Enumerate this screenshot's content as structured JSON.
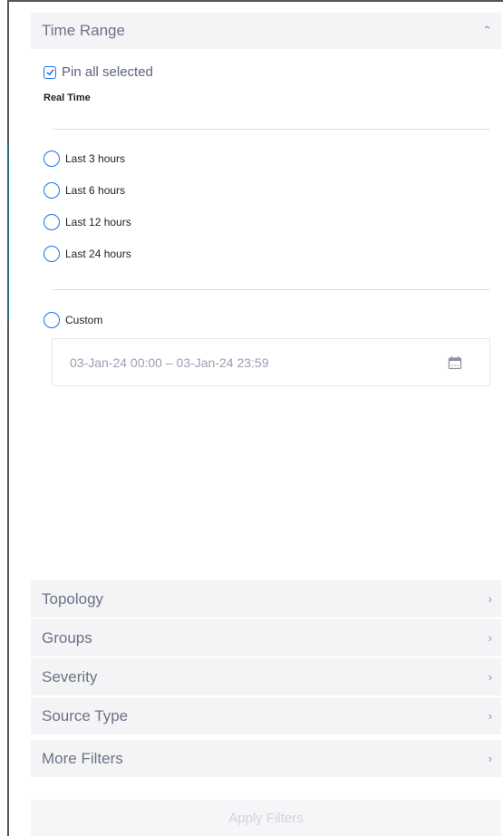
{
  "time_range": {
    "title": "Time Range",
    "pin_label": "Pin all selected",
    "realtime_label": "Real Time",
    "options": [
      {
        "label": "Last 3 hours"
      },
      {
        "label": "Last 6 hours"
      },
      {
        "label": "Last 12 hours"
      },
      {
        "label": "Last 24 hours"
      }
    ],
    "custom_label": "Custom",
    "date_range": "03-Jan-24 00:00 – 03-Jan-24 23:59"
  },
  "sections": [
    {
      "title": "Topology"
    },
    {
      "title": "Groups"
    },
    {
      "title": "Severity"
    },
    {
      "title": "Source Type"
    },
    {
      "title": "More Filters"
    }
  ],
  "apply_label": "Apply Filters",
  "colors": {
    "accent": "#1a73e8",
    "header_bg": "#f4f4f7"
  }
}
